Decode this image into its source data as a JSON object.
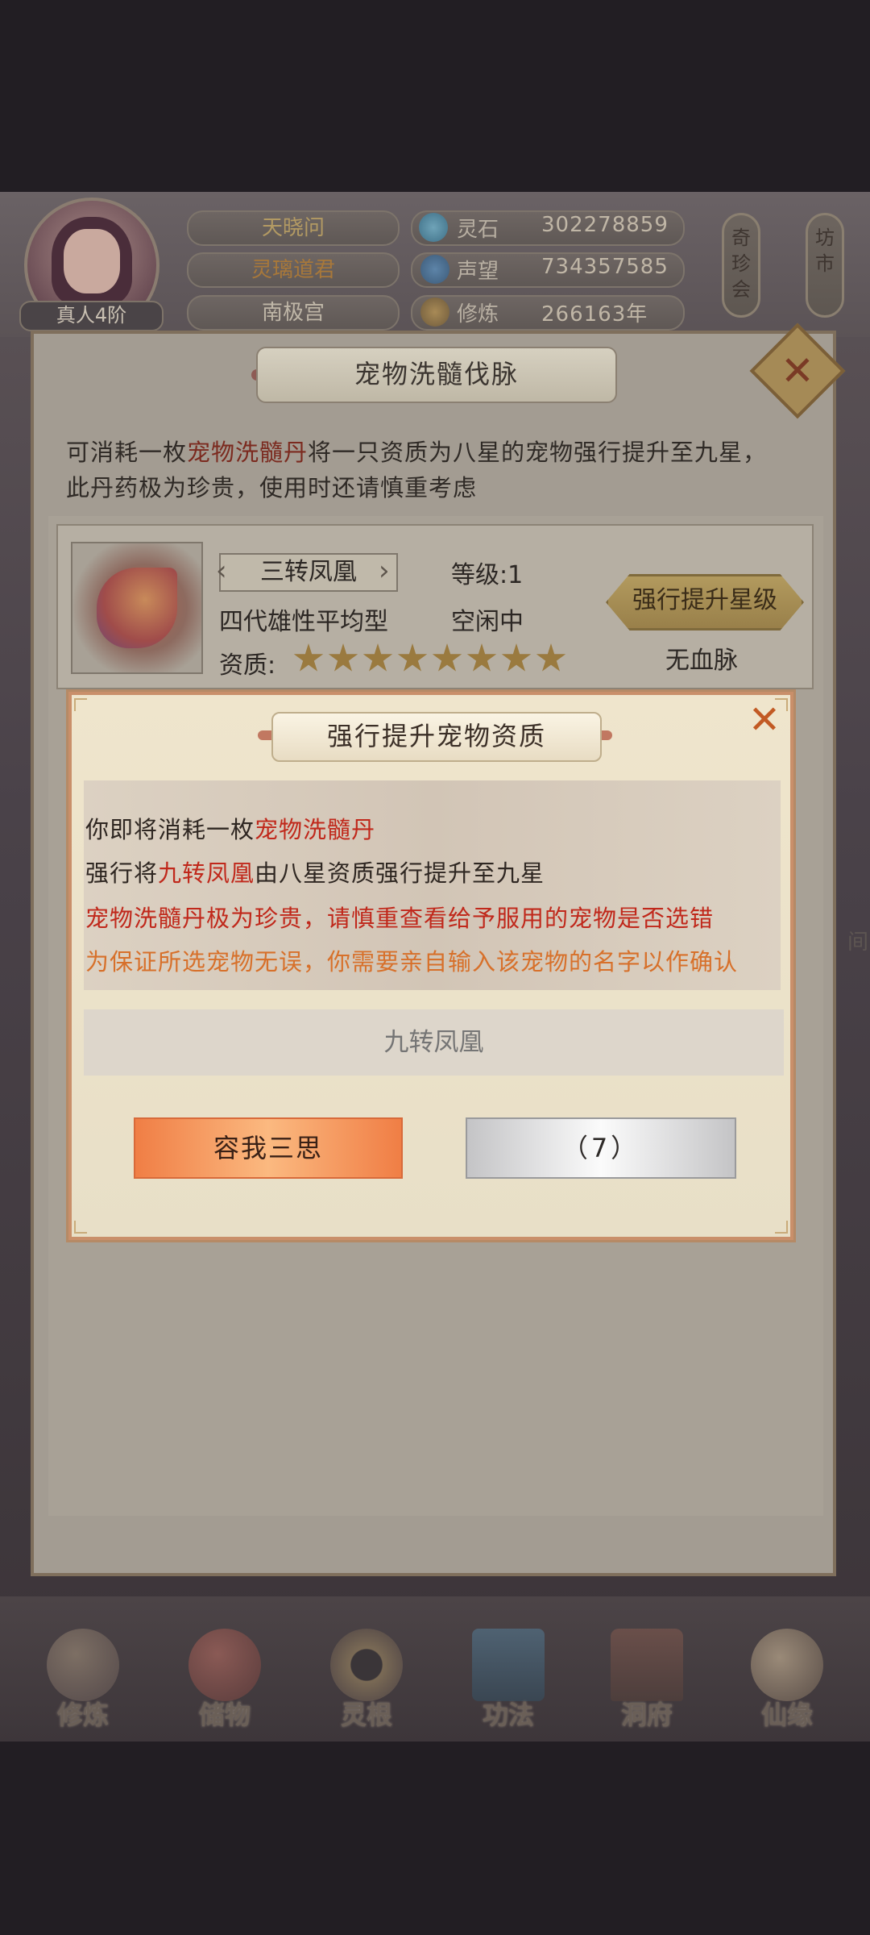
{
  "header": {
    "avatar_rank": "真人4阶",
    "names": [
      "天晓问",
      "灵璃道君",
      "南极宫"
    ],
    "stats": [
      {
        "label": "灵石",
        "value": "302278859",
        "icon": "spirit-stone-icon"
      },
      {
        "label": "声望",
        "value": "734357585",
        "icon": "reputation-icon"
      },
      {
        "label": "修炼",
        "value": "266163年",
        "icon": "cultivation-icon"
      }
    ],
    "side_buttons": [
      "奇珍会",
      "坊市"
    ]
  },
  "panel": {
    "title": "宠物洗髓伐脉",
    "desc_line1_prefix": "可消耗一枚",
    "desc_line1_item": "宠物洗髓丹",
    "desc_line1_suffix": "将一只资质为八星的宠物强行提升至九星，",
    "desc_line2": "此丹药极为珍贵，使用时还请慎重考虑",
    "pet": {
      "name": "三转凤凰",
      "level_label": "等级:",
      "level": "1",
      "type": "四代雄性平均型",
      "status": "空闲中",
      "aptitude_label": "资质:",
      "stars": 8,
      "bloodline": "无血脉",
      "upgrade_button": "强行提升星级"
    }
  },
  "dialog": {
    "title": "强行提升宠物资质",
    "line1_prefix": "你即将消耗一枚",
    "line1_item": "宠物洗髓丹",
    "line2_prefix": "强行将",
    "line2_pet": "九转凤凰",
    "line2_suffix": "由八星资质强行提升至九星",
    "line3": "宠物洗髓丹极为珍贵，请慎重查看给予服用的宠物是否选错",
    "line4": "为保证所选宠物无误，你需要亲自输入该宠物的名字以作确认",
    "input_placeholder": "九转凤凰",
    "cancel_button": "容我三思",
    "confirm_button": "（7）"
  },
  "edge_text": "间",
  "bottom_nav": [
    "修炼",
    "储物",
    "灵根",
    "功法",
    "洞府",
    "仙缘"
  ],
  "colors": {
    "warning_red": "#c0281b",
    "warning_orange": "#d7702a",
    "cancel_button": "#f07e45",
    "confirm_button_disabled": "#c4c4c6"
  }
}
